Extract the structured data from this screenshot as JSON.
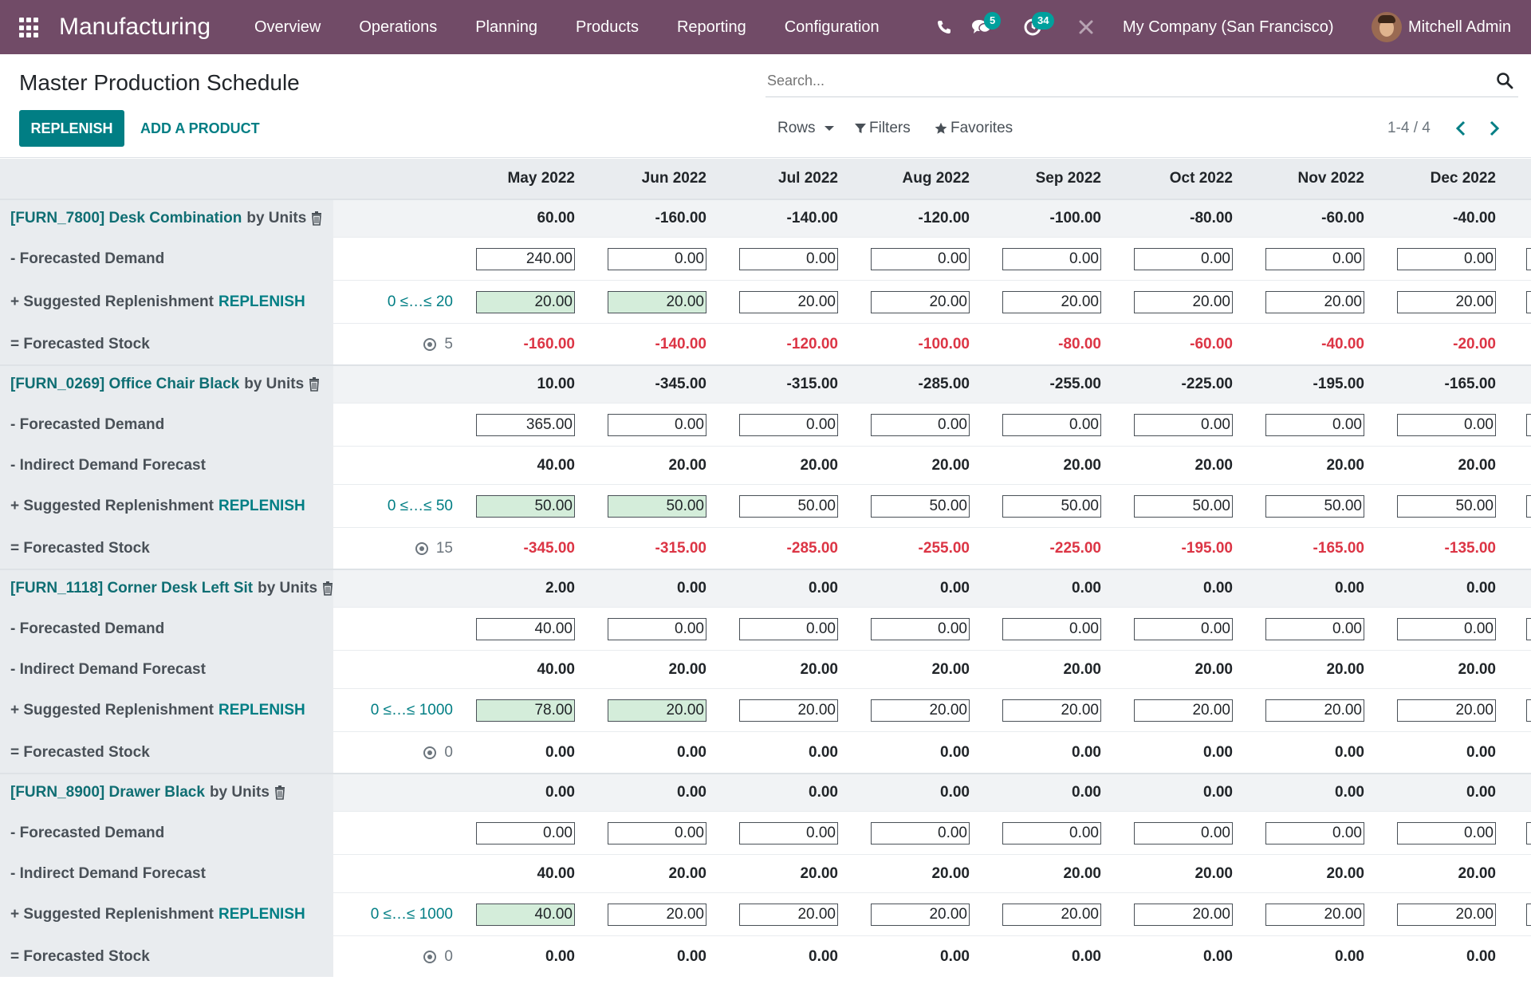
{
  "navbar": {
    "app_title": "Manufacturing",
    "menu": [
      "Overview",
      "Operations",
      "Planning",
      "Products",
      "Reporting",
      "Configuration"
    ],
    "messages_badge": "5",
    "activities_badge": "34",
    "company": "My Company (San Francisco)",
    "user": "Mitchell Admin",
    "icons": [
      "apps-grid-icon",
      "phone-icon",
      "chat-icon",
      "activity-clock-icon",
      "debug-tools-icon"
    ]
  },
  "control_panel": {
    "title": "Master Production Schedule",
    "replenish_button": "REPLENISH",
    "add_product_button": "ADD A PRODUCT",
    "search_placeholder": "Search...",
    "rows_label": "Rows",
    "filters_label": "Filters",
    "favorites_label": "Favorites",
    "pager": "1-4 / 4"
  },
  "months": [
    "May 2022",
    "Jun 2022",
    "Jul 2022",
    "Aug 2022",
    "Sep 2022",
    "Oct 2022",
    "Nov 2022",
    "Dec 2022"
  ],
  "labels": {
    "forecasted_demand": "- Forecasted Demand",
    "indirect_demand": "- Indirect Demand Forecast",
    "suggested_replenishment": "+ Suggested Replenishment",
    "replenish_link": "REPLENISH",
    "forecasted_stock": "= Forecasted Stock",
    "by_units": "by Units"
  },
  "products": [
    {
      "name": "[FURN_7800] Desk Combination",
      "starting": [
        "60.00",
        "-160.00",
        "-140.00",
        "-120.00",
        "-100.00",
        "-80.00",
        "-60.00",
        "-40.00"
      ],
      "forecasted_demand": [
        "240.00",
        "0.00",
        "0.00",
        "0.00",
        "0.00",
        "0.00",
        "0.00",
        "0.00"
      ],
      "indirect_demand": null,
      "replenishment_range": "0 ≤…≤ 20",
      "replenishment": [
        "20.00",
        "20.00",
        "20.00",
        "20.00",
        "20.00",
        "20.00",
        "20.00",
        "20.00"
      ],
      "replenishment_green": [
        true,
        true,
        false,
        false,
        false,
        false,
        false,
        false
      ],
      "safety_stock": "5",
      "forecasted_stock": [
        "-160.00",
        "-140.00",
        "-120.00",
        "-100.00",
        "-80.00",
        "-60.00",
        "-40.00",
        "-20.00"
      ]
    },
    {
      "name": "[FURN_0269] Office Chair Black",
      "starting": [
        "10.00",
        "-345.00",
        "-315.00",
        "-285.00",
        "-255.00",
        "-225.00",
        "-195.00",
        "-165.00"
      ],
      "forecasted_demand": [
        "365.00",
        "0.00",
        "0.00",
        "0.00",
        "0.00",
        "0.00",
        "0.00",
        "0.00"
      ],
      "indirect_demand": [
        "40.00",
        "20.00",
        "20.00",
        "20.00",
        "20.00",
        "20.00",
        "20.00",
        "20.00"
      ],
      "replenishment_range": "0 ≤…≤ 50",
      "replenishment": [
        "50.00",
        "50.00",
        "50.00",
        "50.00",
        "50.00",
        "50.00",
        "50.00",
        "50.00"
      ],
      "replenishment_green": [
        true,
        true,
        false,
        false,
        false,
        false,
        false,
        false
      ],
      "safety_stock": "15",
      "forecasted_stock": [
        "-345.00",
        "-315.00",
        "-285.00",
        "-255.00",
        "-225.00",
        "-195.00",
        "-165.00",
        "-135.00"
      ]
    },
    {
      "name": "[FURN_1118] Corner Desk Left Sit",
      "starting": [
        "2.00",
        "0.00",
        "0.00",
        "0.00",
        "0.00",
        "0.00",
        "0.00",
        "0.00"
      ],
      "forecasted_demand": [
        "40.00",
        "0.00",
        "0.00",
        "0.00",
        "0.00",
        "0.00",
        "0.00",
        "0.00"
      ],
      "indirect_demand": [
        "40.00",
        "20.00",
        "20.00",
        "20.00",
        "20.00",
        "20.00",
        "20.00",
        "20.00"
      ],
      "replenishment_range": "0 ≤…≤ 1000",
      "replenishment": [
        "78.00",
        "20.00",
        "20.00",
        "20.00",
        "20.00",
        "20.00",
        "20.00",
        "20.00"
      ],
      "replenishment_green": [
        true,
        true,
        false,
        false,
        false,
        false,
        false,
        false
      ],
      "safety_stock": "0",
      "forecasted_stock": [
        "0.00",
        "0.00",
        "0.00",
        "0.00",
        "0.00",
        "0.00",
        "0.00",
        "0.00"
      ]
    },
    {
      "name": "[FURN_8900] Drawer Black",
      "starting": [
        "0.00",
        "0.00",
        "0.00",
        "0.00",
        "0.00",
        "0.00",
        "0.00",
        "0.00"
      ],
      "forecasted_demand": [
        "0.00",
        "0.00",
        "0.00",
        "0.00",
        "0.00",
        "0.00",
        "0.00",
        "0.00"
      ],
      "indirect_demand": [
        "40.00",
        "20.00",
        "20.00",
        "20.00",
        "20.00",
        "20.00",
        "20.00",
        "20.00"
      ],
      "replenishment_range": "0 ≤…≤ 1000",
      "replenishment": [
        "40.00",
        "20.00",
        "20.00",
        "20.00",
        "20.00",
        "20.00",
        "20.00",
        "20.00"
      ],
      "replenishment_green": [
        true,
        false,
        false,
        false,
        false,
        false,
        false,
        false
      ],
      "safety_stock": "0",
      "forecasted_stock": [
        "0.00",
        "0.00",
        "0.00",
        "0.00",
        "0.00",
        "0.00",
        "0.00",
        "0.00"
      ]
    }
  ],
  "colors": {
    "navbar": "#714b67",
    "primary": "#017e84",
    "negative": "#dc3545",
    "green_cell": "#d4edda"
  }
}
